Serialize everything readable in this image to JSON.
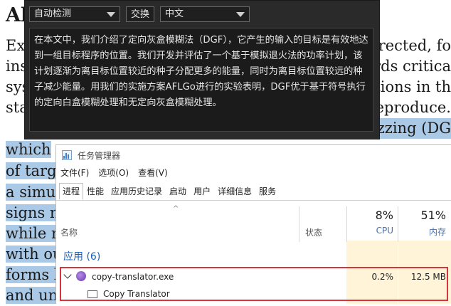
{
  "document": {
    "heading": "Al",
    "lines_left": [
      "Ex",
      "ins",
      "sys",
      "sta",
      "which",
      "of targ",
      "a simu",
      "signs n",
      "while r",
      "with ou",
      "forms l",
      "and un"
    ],
    "lines_right": [
      "directed, fo",
      "ards critica",
      "tions in th",
      "reproduce.",
      "zzing (DG"
    ]
  },
  "translator": {
    "source_language": "自动检测",
    "swap_label": "交换",
    "target_language": "中文",
    "output_text": "在本文中，我们介绍了定向灰盒模糊法（DGF），它产生的输入的目标是有效地达到一组目标程序的位置。我们开发并评估了一个基于模拟退火法的功率计划，该计划逐渐为离目标位置较近的种子分配更多的能量，同时为离目标位置较远的种子减少能量。用我们的实施方案AFLGo进行的实验表明，DGF优于基于符号执行的定向白盒模糊处理和无定向灰盒模糊处理。"
  },
  "taskmgr": {
    "title": "任务管理器",
    "menu": [
      "文件(F)",
      "选项(O)",
      "查看(V)"
    ],
    "tabs": [
      "进程",
      "性能",
      "应用历史记录",
      "启动",
      "用户",
      "详细信息",
      "服务"
    ],
    "columns": {
      "sort_indicator": "^",
      "name": "名称",
      "status": "状态",
      "cpu_total": "8%",
      "cpu": "CPU",
      "memory_total": "51%",
      "memory": "内存"
    },
    "group": "应用 (6)",
    "process": {
      "name": "copy-translator.exe",
      "cpu": "0.2%",
      "memory": "12.5 MB",
      "window": "Copy Translator"
    }
  }
}
